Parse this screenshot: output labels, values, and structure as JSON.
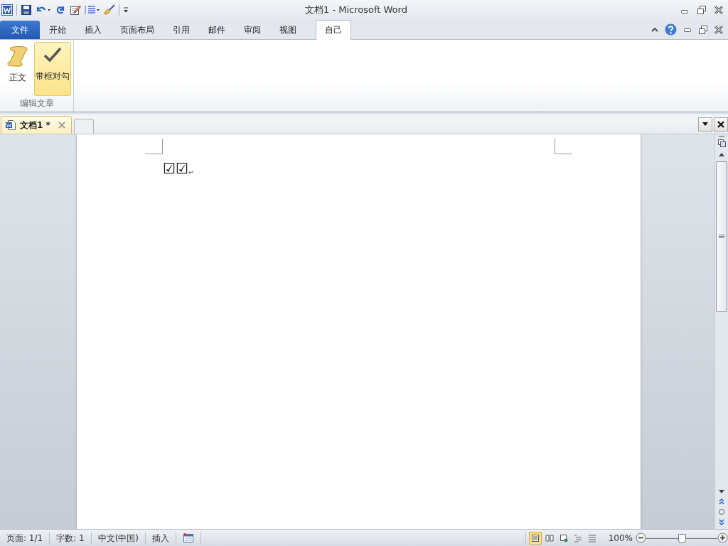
{
  "window": {
    "title": "文档1 - Microsoft Word"
  },
  "ribbon_tabs": [
    {
      "label": "文件",
      "kind": "file",
      "selected": false
    },
    {
      "label": "开始",
      "kind": "tab",
      "selected": false
    },
    {
      "label": "插入",
      "kind": "tab",
      "selected": false
    },
    {
      "label": "页面布局",
      "kind": "tab",
      "selected": false
    },
    {
      "label": "引用",
      "kind": "tab",
      "selected": false
    },
    {
      "label": "邮件",
      "kind": "tab",
      "selected": false
    },
    {
      "label": "审阅",
      "kind": "tab",
      "selected": false
    },
    {
      "label": "视图",
      "kind": "tab",
      "selected": false
    },
    {
      "label": "自己",
      "kind": "tab",
      "selected": true
    }
  ],
  "ribbon": {
    "group_label": "编辑文章",
    "buttons": [
      {
        "label": "正文",
        "kind": "scroll",
        "selected": false
      },
      {
        "label": "带框对勾",
        "kind": "check",
        "selected": true
      }
    ]
  },
  "document_tabs": [
    {
      "label": "文档1 *",
      "selected": true
    }
  ],
  "document": {
    "text": "☑☑",
    "paragraph_mark": "↵"
  },
  "status_bar": {
    "items": [
      "页面: 1/1",
      "字数: 1",
      "中文(中国)",
      "插入"
    ],
    "view_buttons": [
      {
        "selected": true
      },
      {
        "selected": false
      },
      {
        "selected": false
      },
      {
        "selected": false
      },
      {
        "selected": false
      }
    ],
    "zoom": "100%",
    "zoom_slider": {
      "level": 0.5
    }
  }
}
